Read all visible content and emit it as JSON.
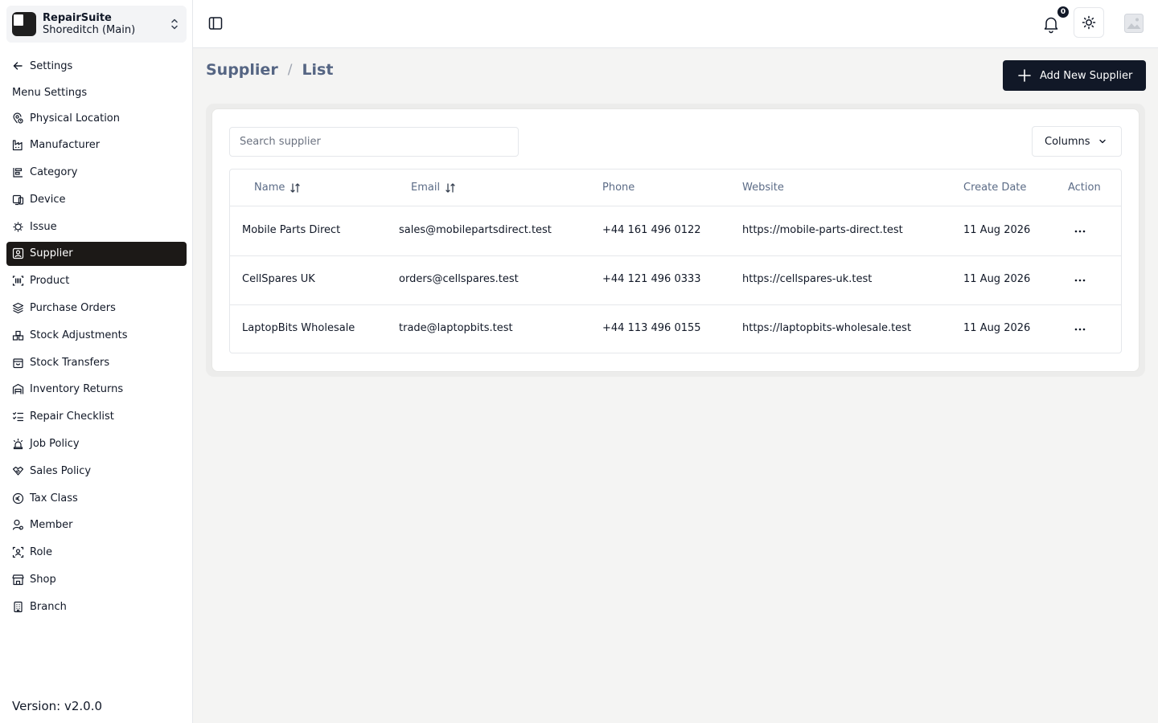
{
  "shop": {
    "name": "RepairSuite",
    "branch": "Shoreditch (Main)"
  },
  "sidebar": {
    "back_label": "Settings",
    "section_label": "Menu Settings",
    "items": [
      {
        "label": "Physical Location",
        "icon": "location-icon"
      },
      {
        "label": "Manufacturer",
        "icon": "factory-icon"
      },
      {
        "label": "Category",
        "icon": "category-icon"
      },
      {
        "label": "Device",
        "icon": "device-icon"
      },
      {
        "label": "Issue",
        "icon": "bug-icon"
      },
      {
        "label": "Supplier",
        "icon": "supplier-icon",
        "active": true
      },
      {
        "label": "Product",
        "icon": "barcode-icon"
      },
      {
        "label": "Purchase Orders",
        "icon": "layers-icon"
      },
      {
        "label": "Stock Adjustments",
        "icon": "adjust-icon"
      },
      {
        "label": "Stock Transfers",
        "icon": "package-icon"
      },
      {
        "label": "Inventory Returns",
        "icon": "warehouse-icon"
      },
      {
        "label": "Repair Checklist",
        "icon": "checklist-icon"
      },
      {
        "label": "Job Policy",
        "icon": "siren-icon"
      },
      {
        "label": "Sales Policy",
        "icon": "handshake-icon"
      },
      {
        "label": "Tax Class",
        "icon": "euro-icon"
      },
      {
        "label": "Member",
        "icon": "user-icon"
      },
      {
        "label": "Role",
        "icon": "role-icon"
      },
      {
        "label": "Shop",
        "icon": "store-icon"
      },
      {
        "label": "Branch",
        "icon": "building-icon"
      }
    ],
    "version": "Version: v2.0.0"
  },
  "topbar": {
    "notification_count": "0"
  },
  "breadcrumb": {
    "section": "Supplier",
    "separator": "/",
    "page": "List"
  },
  "actions": {
    "add_label": "Add New Supplier",
    "columns_label": "Columns"
  },
  "search": {
    "placeholder": "Search supplier"
  },
  "table": {
    "headers": {
      "name": "Name",
      "email": "Email",
      "phone": "Phone",
      "website": "Website",
      "created": "Create Date",
      "action": "Action"
    },
    "rows": [
      {
        "name": "Mobile Parts Direct",
        "email": "sales@mobilepartsdirect.test",
        "phone": "+44 161 496 0122",
        "website": "https://mobile-parts-direct.test",
        "created": "11 Aug 2026"
      },
      {
        "name": "CellSpares UK",
        "email": "orders@cellspares.test",
        "phone": "+44 121 496 0333",
        "website": "https://cellspares-uk.test",
        "created": "11 Aug 2026"
      },
      {
        "name": "LaptopBits Wholesale",
        "email": "trade@laptopbits.test",
        "phone": "+44 113 496 0155",
        "website": "https://laptopbits-wholesale.test",
        "created": "11 Aug 2026"
      }
    ]
  },
  "colors": {
    "primary": "#111827",
    "active_nav": "#1c1917",
    "breadcrumb": "#556583",
    "page_bg": "#f4f4f3"
  }
}
